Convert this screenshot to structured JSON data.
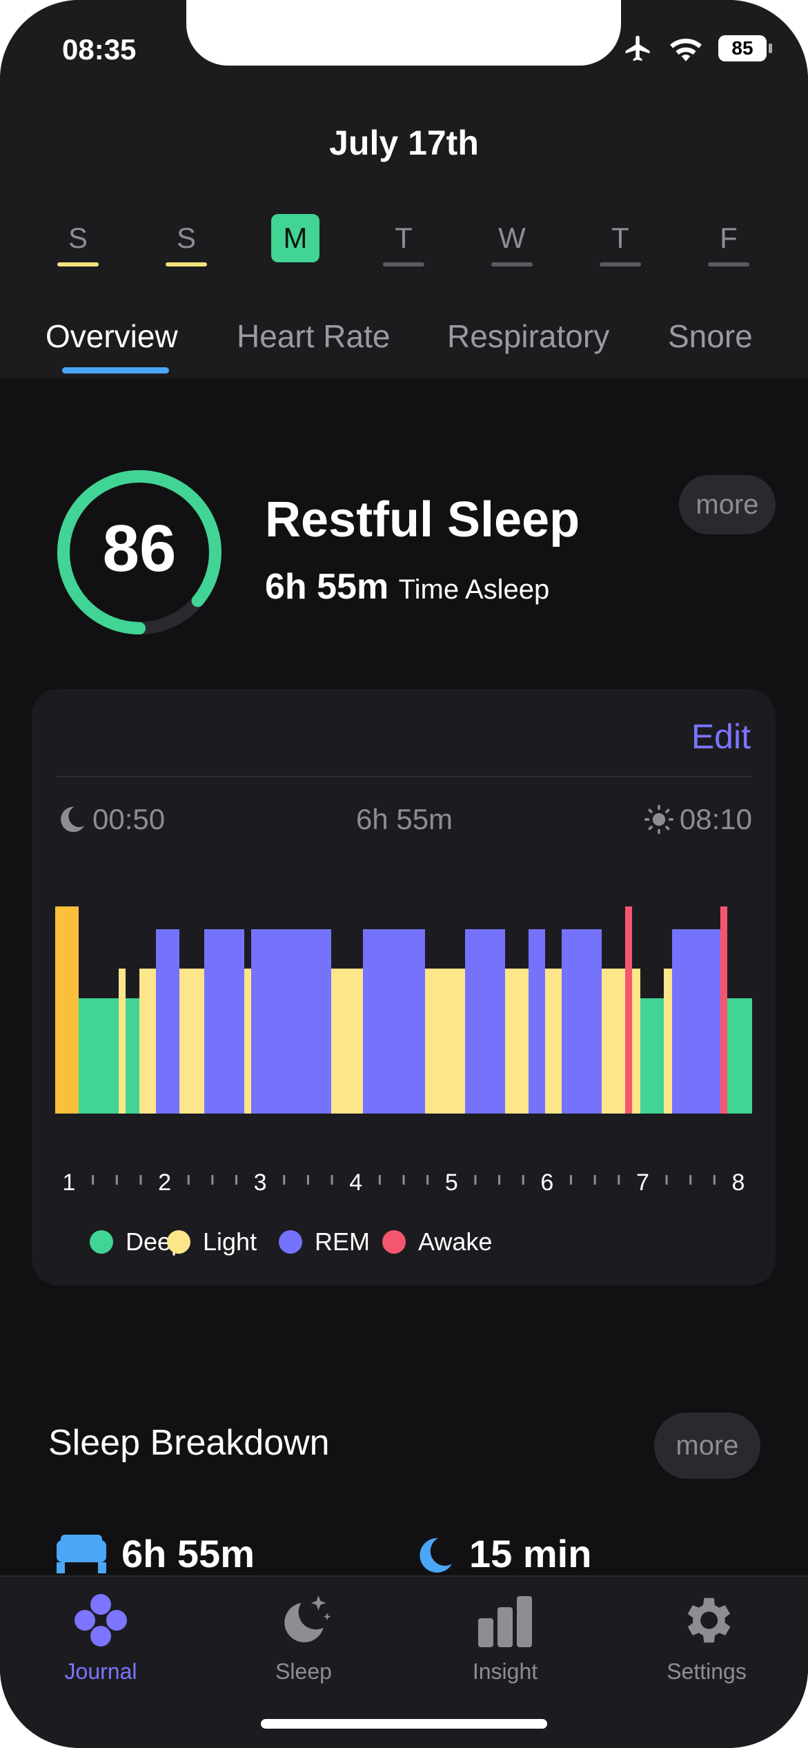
{
  "status_bar": {
    "time": "08:35",
    "battery": "85"
  },
  "header": {
    "date": "July 17th"
  },
  "week_days": [
    {
      "letter": "S",
      "marker_color": "#f4e37b",
      "active": false
    },
    {
      "letter": "S",
      "marker_color": "#f4e37b",
      "active": false
    },
    {
      "letter": "M",
      "marker_color": "#41d494",
      "active": true
    },
    {
      "letter": "T",
      "marker_color": "#5b5b61",
      "active": false
    },
    {
      "letter": "W",
      "marker_color": "#5b5b61",
      "active": false
    },
    {
      "letter": "T",
      "marker_color": "#5b5b61",
      "active": false
    },
    {
      "letter": "F",
      "marker_color": "#5b5b61",
      "active": false
    }
  ],
  "tabs": [
    {
      "label": "Overview",
      "active": true
    },
    {
      "label": "Heart Rate",
      "active": false
    },
    {
      "label": "Respiratory",
      "active": false
    },
    {
      "label": "Snore",
      "active": false
    }
  ],
  "summary": {
    "score": "86",
    "score_fraction": 0.86,
    "title": "Restful Sleep",
    "duration": "6h 55m",
    "duration_label": "Time Asleep",
    "more_label": "more"
  },
  "hypnogram_card": {
    "edit_label": "Edit",
    "bedtime": "00:50",
    "total": "6h 55m",
    "wake_time": "08:10",
    "axis_labels": [
      "1",
      "2",
      "3",
      "4",
      "5",
      "6",
      "7",
      "8"
    ],
    "legend": [
      {
        "label": "Deep",
        "color": "#41d494"
      },
      {
        "label": "Light",
        "color": "#fde58a"
      },
      {
        "label": "REM",
        "color": "#7572fb"
      },
      {
        "label": "Awake",
        "color": "#f5566f"
      }
    ]
  },
  "breakdown": {
    "title": "Sleep Breakdown",
    "more_label": "more",
    "stat1": {
      "value": "6h 55m",
      "icon": "bed-icon"
    },
    "stat2": {
      "value": "15 min",
      "icon": "moon-icon"
    }
  },
  "tab_bar": [
    {
      "label": "Journal",
      "icon": "journal-icon",
      "active": true
    },
    {
      "label": "Sleep",
      "icon": "moon-stars-icon",
      "active": false
    },
    {
      "label": "Insight",
      "icon": "bar-chart-icon",
      "active": false
    },
    {
      "label": "Settings",
      "icon": "gear-icon",
      "active": false
    }
  ],
  "colors": {
    "accent": "#7b75ff",
    "score_ring": "#41d494",
    "tab_underline": "#4aa7f5",
    "background": "#111113"
  }
}
